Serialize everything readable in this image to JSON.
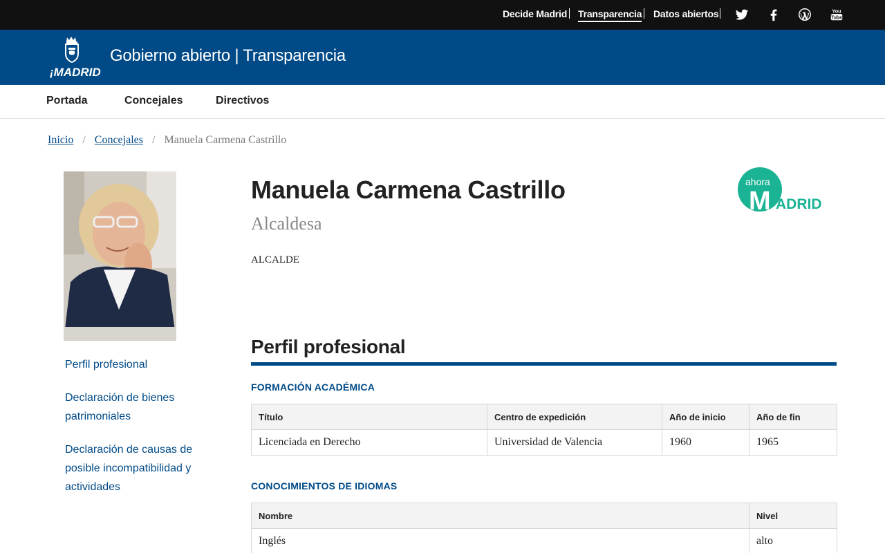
{
  "topbar": {
    "links": [
      {
        "label": "Decide Madrid",
        "active": false
      },
      {
        "label": "Transparencia",
        "active": true
      },
      {
        "label": "Datos abiertos",
        "active": false
      }
    ],
    "social": [
      "twitter-icon",
      "facebook-icon",
      "wordpress-icon",
      "youtube-icon"
    ]
  },
  "header": {
    "logo_text": "¡MADRID!",
    "site_title": "Gobierno abierto | Transparencia",
    "color": "#004a87"
  },
  "mainnav": {
    "items": [
      "Portada",
      "Concejales",
      "Directivos"
    ]
  },
  "breadcrumb": {
    "items": [
      "Inicio",
      "Concejales"
    ],
    "current": "Manuela Carmena Castrillo"
  },
  "profile": {
    "name": "Manuela Carmena Castrillo",
    "role": "Alcaldesa",
    "position": "ALCALDE",
    "party_logo": {
      "small": "ahora",
      "big_letter": "M",
      "rest": "ADRID",
      "color": "#1ab394"
    }
  },
  "sidenav": {
    "items": [
      "Perfil profesional",
      "Declaración de bienes patrimoniales",
      "Declaración de causas de posible incompatibilidad y actividades"
    ]
  },
  "section": {
    "title": "Perfil profesional"
  },
  "formacion": {
    "title": "FORMACIÓN ACADÉMICA",
    "headers": [
      "Título",
      "Centro de expedición",
      "Año de inicio",
      "Año de fin"
    ],
    "rows": [
      [
        "Licenciada en Derecho",
        "Universidad de Valencia",
        "1960",
        "1965"
      ]
    ]
  },
  "idiomas": {
    "title": "CONOCIMIENTOS DE IDIOMAS",
    "headers": [
      "Nombre",
      "Nivel"
    ],
    "rows": [
      [
        "Inglés",
        "alto"
      ]
    ]
  }
}
